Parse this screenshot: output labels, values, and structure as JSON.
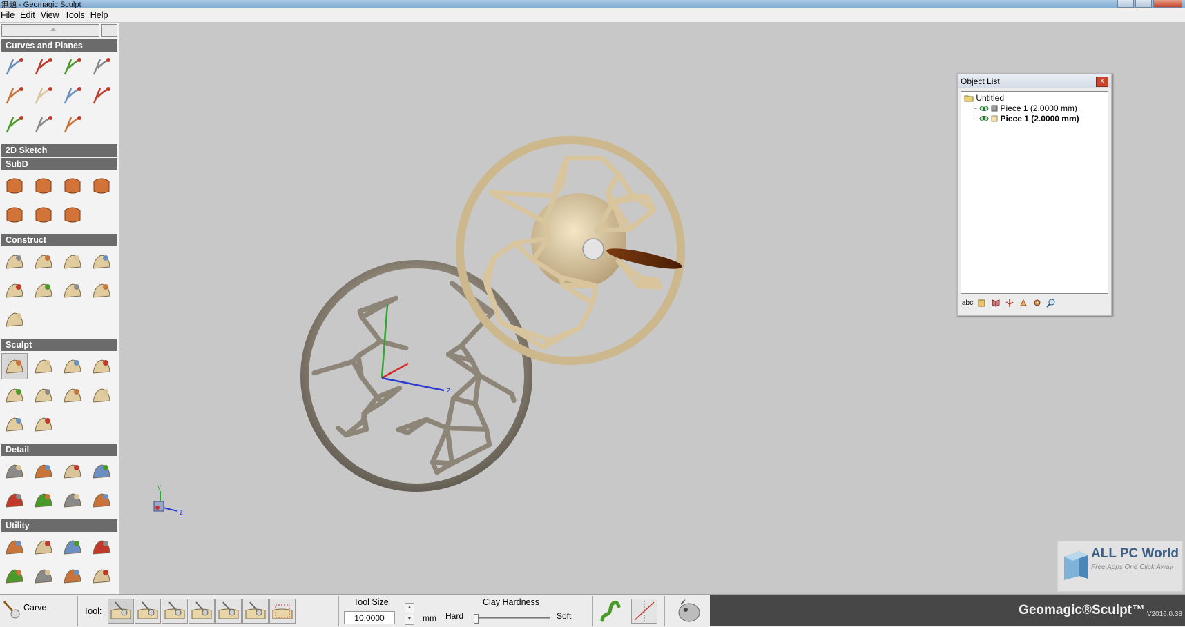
{
  "window": {
    "title": "無題 - Geomagic Sculpt"
  },
  "menu": [
    "File",
    "Edit",
    "View",
    "Tools",
    "Help"
  ],
  "sidebar": {
    "sections": [
      {
        "name": "Curves and Planes",
        "icons": [
          "select-arrow",
          "pencil-curve",
          "edit-curve",
          "curve-extend",
          "line-segment",
          "mirror",
          "sphere-plane",
          "plane-cut",
          "plane-grid",
          "project-curve",
          "sphere-curve"
        ]
      },
      {
        "name": "2D Sketch",
        "icons": []
      },
      {
        "name": "SubD",
        "icons": [
          "subd-patch",
          "subd-cube",
          "subd-torus",
          "subd-cylinder",
          "subd-plane",
          "subd-blob",
          "subd-sphere"
        ]
      },
      {
        "name": "Construct",
        "icons": [
          "extrude",
          "sweep",
          "loft",
          "cube-block",
          "slab",
          "blob",
          "patch-sphere",
          "capsule",
          "cube-frame"
        ]
      },
      {
        "name": "Sculpt",
        "icons": [
          "carve",
          "smudge",
          "smooth-press",
          "brush",
          "inflate",
          "flat-sand",
          "curve-cut",
          "emboss",
          "figure",
          "head"
        ]
      },
      {
        "name": "Detail",
        "icons": [
          "emboss-figure",
          "texture-honeycomb",
          "texture-ball",
          "swirl",
          "curve-detail",
          "spikes",
          "polyhedron",
          "color-paint"
        ]
      },
      {
        "name": "Utility",
        "icons": [
          "boolean-blocks",
          "split-piece",
          "box-frame",
          "sword-cut",
          "clay-texture",
          "square-inset",
          "move-axes",
          "star-axes"
        ]
      }
    ]
  },
  "object_list": {
    "title": "Object List",
    "close": "x",
    "root": "Untitled",
    "items": [
      {
        "label": "Piece 1 (2.0000 mm)",
        "bold": false
      },
      {
        "label": "Piece 1 (2.0000 mm)",
        "bold": true
      }
    ],
    "bottom_icons": [
      "abc-label",
      "piece-icon",
      "mirror-icon",
      "pin-icon",
      "hand-icon",
      "gear-icon",
      "find-icon"
    ],
    "abc": "abc"
  },
  "axes": {
    "x": "x",
    "y": "y",
    "z": "z"
  },
  "statusbar": {
    "current_tool": "Carve",
    "tool_label": "Tool:",
    "tool_size_label": "Tool Size",
    "tool_size_value": "10.0000",
    "unit": "mm",
    "clay_hardness_label": "Clay Hardness",
    "hard_label": "Hard",
    "soft_label": "Soft",
    "brand": "Geomagic®Sculpt™",
    "version": "V2016.0.38"
  },
  "watermark": {
    "title": "ALL PC World",
    "subtitle": "Free Apps One Click Away"
  },
  "colors": {
    "section_header": "#6b6b6b",
    "sidebar_bg": "#f3f3f3",
    "viewport_bg": "#c8c8c8",
    "brand_bg": "#474747",
    "ball_light": "#e6d3a8",
    "ball_dark": "#8c8375"
  }
}
